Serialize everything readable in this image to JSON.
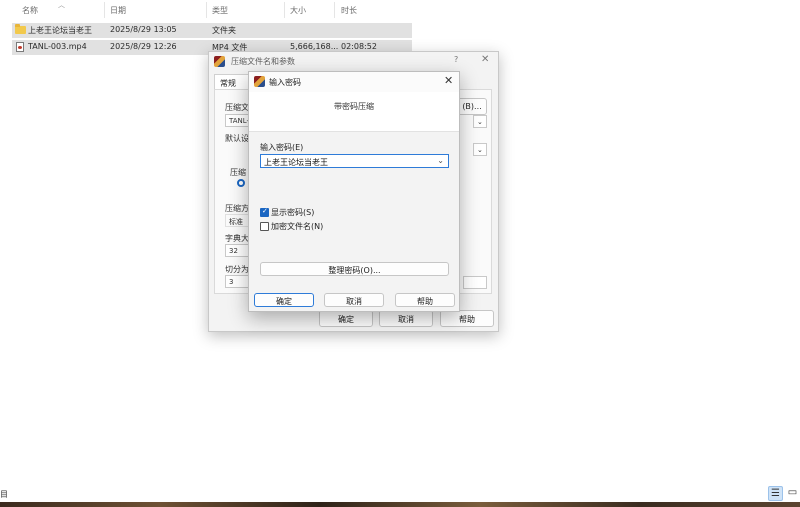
{
  "explorer": {
    "columns": [
      "名称",
      "日期",
      "类型",
      "大小",
      "时长"
    ],
    "rows": [
      {
        "name": "上老王论坛当老王",
        "date": "2025/8/29 13:05",
        "type": "文件夹",
        "size": "",
        "duration": "",
        "icon": "folder-icon"
      },
      {
        "name": "TANL-003.mp4",
        "date": "2025/8/29 12:26",
        "type": "MP4 文件",
        "size": "5,666,168...",
        "duration": "02:08:52",
        "icon": "video-file-icon"
      }
    ],
    "status_count": "目"
  },
  "back_dialog": {
    "title": "压缩文件名和参数",
    "help_glyph": "?",
    "close_glyph": "✕",
    "tab_general": "常规",
    "label_archive": "压缩文",
    "field_archive": "TANL-(",
    "browse_btn": "(B)...",
    "label_default": "默认设",
    "label_compress": "压缩",
    "label_method": "压缩方",
    "field_method": "标准",
    "label_dict": "字典大",
    "field_dict": "32",
    "label_split": "切分为",
    "field_split": "3",
    "ok": "确定",
    "cancel": "取消",
    "help": "帮助"
  },
  "front_dialog": {
    "title": "输入密码",
    "subtitle": "带密码压缩",
    "label_password": "输入密码(E)",
    "password_value": "上老王论坛当老王",
    "show_password": "显示密码(S)",
    "show_password_checked": true,
    "encrypt_names": "加密文件名(N)",
    "encrypt_names_checked": false,
    "organize_btn": "整理密码(O)...",
    "ok": "确定",
    "cancel": "取消",
    "help": "帮助",
    "close_glyph": "✕"
  },
  "accent_color": "#1a66c2"
}
